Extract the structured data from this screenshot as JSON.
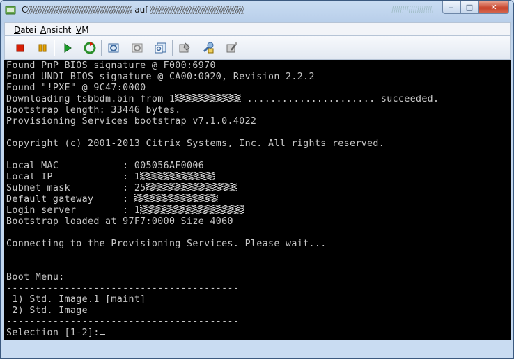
{
  "window": {
    "title_prefix": "C",
    "title_middle": "auf",
    "buttons": {
      "minimize": "‒",
      "maximize": "□",
      "close": "✕"
    }
  },
  "menu": {
    "items": [
      {
        "label": "Datei"
      },
      {
        "label": "Ansicht"
      },
      {
        "label": "VM"
      }
    ]
  },
  "toolbar": {
    "icons": [
      "stop-icon",
      "pause-icon",
      "play-icon",
      "reset-icon",
      "snapshot-icon",
      "revert-snapshot-icon",
      "snapshot-manager-icon",
      "connect-device-icon",
      "settings-icon",
      "tools-icon"
    ],
    "colors": {
      "stop": "#d81e05",
      "pause": "#e8a400",
      "play": "#1b9c2a",
      "reset": "#2b8f2b"
    }
  },
  "console": {
    "lines": [
      {
        "text": "Found PnP BIOS signature @ F000:6970"
      },
      {
        "text": "Found UNDI BIOS signature @ CA00:0020, Revision 2.2.2"
      },
      {
        "text": "Found \"!PXE\" @ 9C47:0000"
      },
      {
        "text": "Downloading tsbbdm.bin from 1",
        "after": " ...................... succeeded."
      },
      {
        "text": "Bootstrap length: 33446 bytes."
      },
      {
        "text": "Provisioning Services bootstrap v7.1.0.4022"
      },
      {
        "text": ""
      },
      {
        "text": "Copyright (c) 2001-2013 Citrix Systems, Inc. All rights reserved."
      },
      {
        "text": ""
      },
      {
        "text": "Local MAC           : 005056AF0006"
      },
      {
        "text": "Local IP            : 1"
      },
      {
        "text": "Subnet mask         : 25"
      },
      {
        "text": "Default gateway     :"
      },
      {
        "text": "Login server        : 1"
      },
      {
        "text": "Bootstrap loaded at 97F7:0000 Size 4060"
      },
      {
        "text": ""
      },
      {
        "text": "Connecting to the Provisioning Services. Please wait..."
      },
      {
        "text": ""
      },
      {
        "text": ""
      },
      {
        "text": "Boot Menu:"
      },
      {
        "text": "----------------------------------------"
      },
      {
        "text": " 1) Std. Image.1 [maint]"
      },
      {
        "text": " 2) Std. Image"
      },
      {
        "text": "----------------------------------------"
      },
      {
        "text": "Selection [1-2]:"
      }
    ]
  }
}
